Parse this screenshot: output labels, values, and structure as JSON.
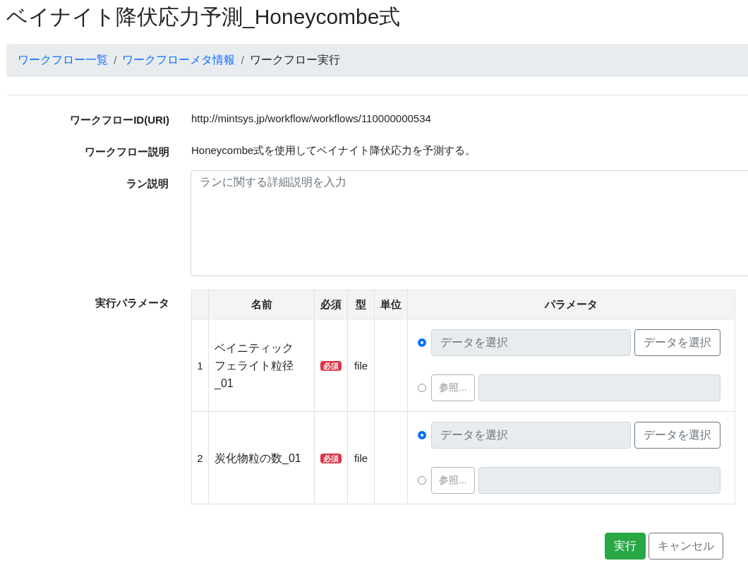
{
  "title": "ベイナイト降伏応力予測_Honeycombe式",
  "breadcrumb": [
    {
      "label": "ワークフロー一覧",
      "link": true
    },
    {
      "label": "ワークフローメタ情報",
      "link": true
    },
    {
      "label": "ワークフロー実行",
      "link": false
    }
  ],
  "breadcrumb_separator": "/",
  "fields": [
    {
      "label": "ワークフローID(URI)",
      "kind": "text",
      "value": "http://mintsys.jp/workflow/workflows/110000000534"
    },
    {
      "label": "ワークフロー説明",
      "kind": "text",
      "value": "Honeycombe式を使用してベイナイト降伏応力を予測する。"
    },
    {
      "label": "ラン説明",
      "kind": "textarea",
      "placeholder": "ランに関する詳細説明を入力"
    }
  ],
  "parameters": {
    "label": "実行パラメータ",
    "columns": [
      "名前",
      "必須",
      "型",
      "単位",
      "パラメータ"
    ],
    "rows": [
      {
        "index": "1",
        "name": "ベイニティックフェライト粒径_01",
        "required": "必須",
        "type": "file",
        "options": [
          {
            "kind": "data",
            "selected": true,
            "placeholder": "データを選択",
            "button": "データを選択"
          },
          {
            "kind": "file",
            "selected": false,
            "button": "参照..."
          }
        ]
      },
      {
        "index": "2",
        "name": "炭化物粒の数_01",
        "required": "必須",
        "type": "file",
        "options": [
          {
            "kind": "data",
            "selected": true,
            "placeholder": "データを選択",
            "button": "データを選択"
          },
          {
            "kind": "file",
            "selected": false,
            "button": "参照..."
          }
        ]
      }
    ]
  },
  "buttons": [
    {
      "label": "実行",
      "kind": "primary"
    },
    {
      "label": "キャンセル",
      "kind": "secondary"
    }
  ]
}
